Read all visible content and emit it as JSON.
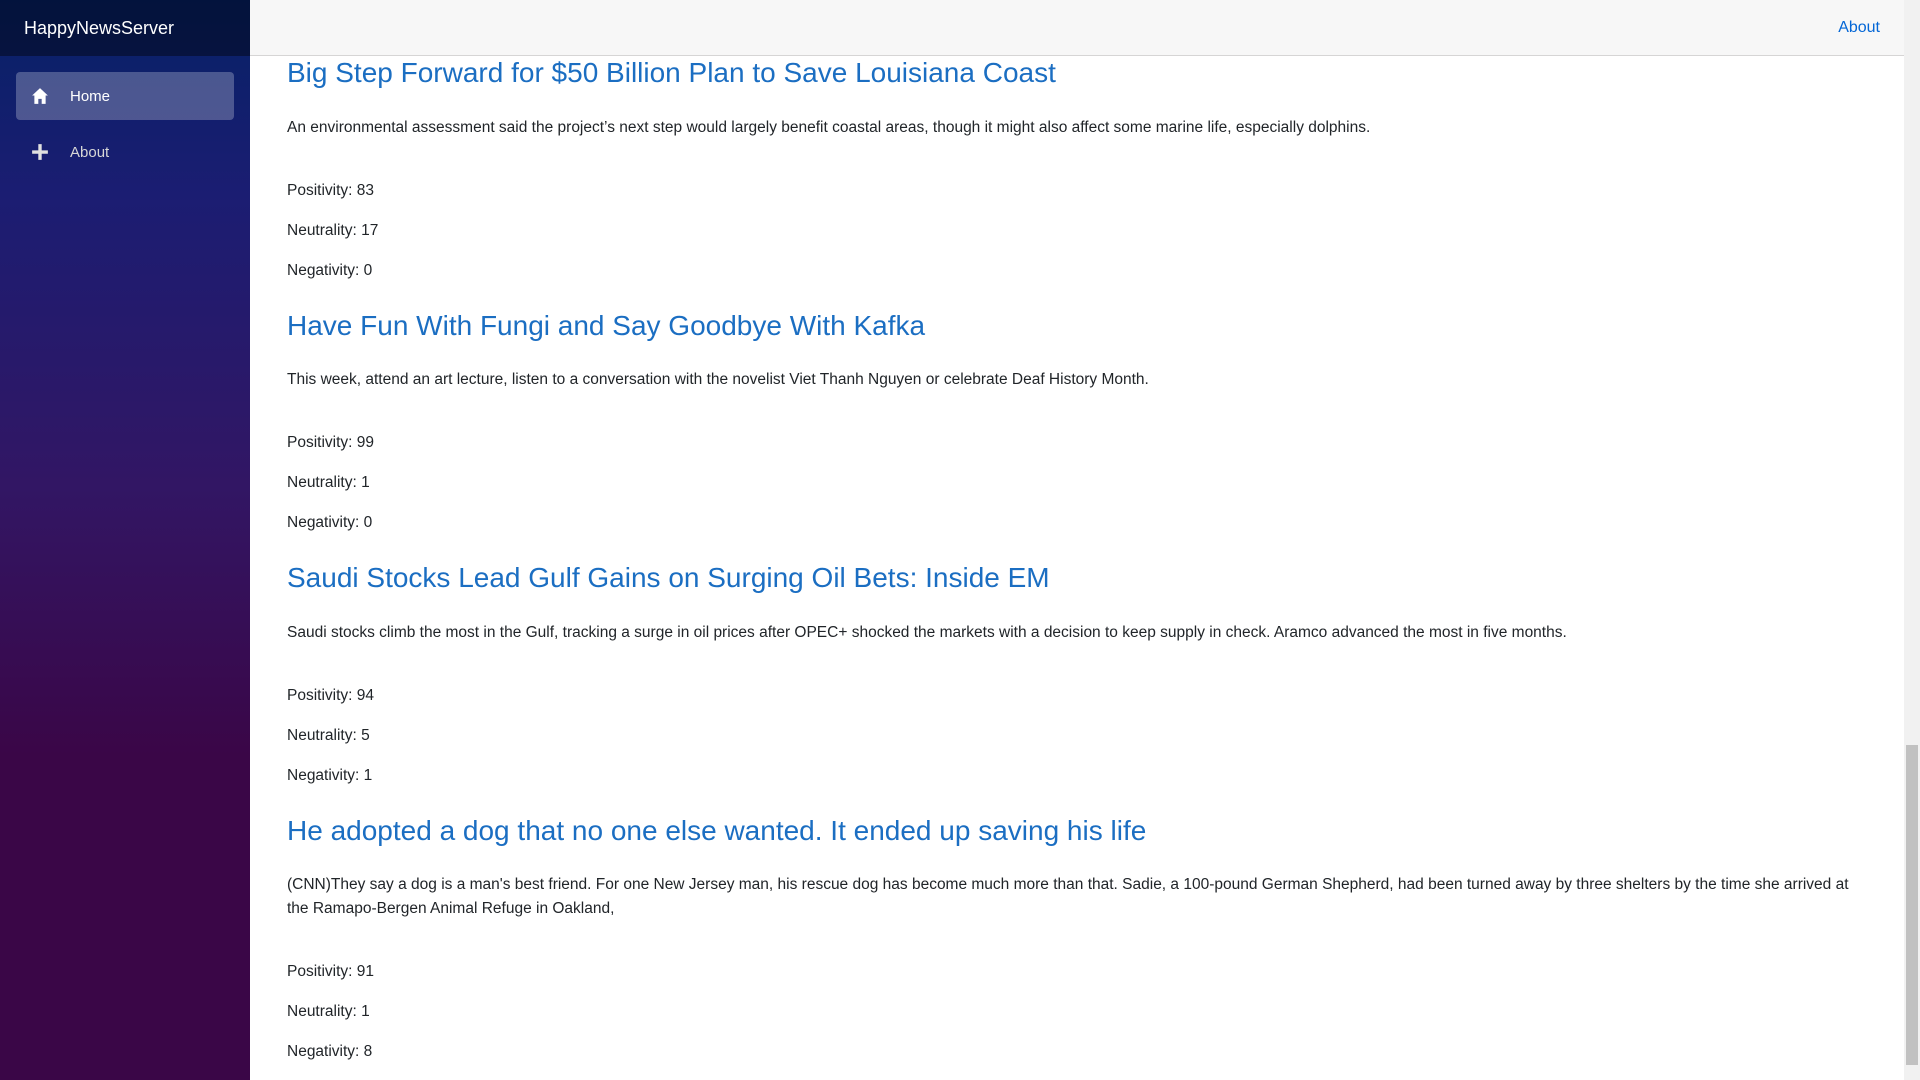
{
  "app": {
    "brand": "HappyNewsServer"
  },
  "sidebar": {
    "items": [
      {
        "label": "Home",
        "icon": "home-icon",
        "active": true
      },
      {
        "label": "About",
        "icon": "plus-icon",
        "active": false
      }
    ]
  },
  "topbar": {
    "about_label": "About"
  },
  "articles": [
    {
      "title": "Big Step Forward for $50 Billion Plan to Save Louisiana Coast",
      "description": "An environmental assessment said the project’s next step would largely benefit coastal areas, though it might also affect some marine life, especially dolphins.",
      "positivity": "Positivity: 83",
      "neutrality": "Neutrality: 17",
      "negativity": "Negativity: 0"
    },
    {
      "title": "Have Fun With Fungi and Say Goodbye With Kafka",
      "description": "This week, attend an art lecture, listen to a conversation with the novelist Viet Thanh Nguyen or celebrate Deaf History Month.",
      "positivity": "Positivity: 99",
      "neutrality": "Neutrality: 1",
      "negativity": "Negativity: 0"
    },
    {
      "title": "Saudi Stocks Lead Gulf Gains on Surging Oil Bets: Inside EM",
      "description": "Saudi stocks climb the most in the Gulf, tracking a surge in oil prices after OPEC+ shocked the markets with a decision to keep supply in check. Aramco advanced the most in five months.",
      "positivity": "Positivity: 94",
      "neutrality": "Neutrality: 5",
      "negativity": "Negativity: 1"
    },
    {
      "title": "He adopted a dog that no one else wanted. It ended up saving his life",
      "description": "(CNN)They say a dog is a man's best friend. For one New Jersey man, his rescue dog has become much more than that. Sadie, a 100-pound German Shepherd, had been turned away by three shelters by the time she arrived at the Ramapo-Bergen Animal Refuge in Oakland,",
      "positivity": "Positivity: 91",
      "neutrality": "Neutrality: 1",
      "negativity": "Negativity: 8"
    }
  ],
  "colors": {
    "link": "#1b6ec2",
    "top_link": "#0366d6",
    "sidebar_top": "#062166",
    "sidebar_bottom": "#3a0647"
  }
}
